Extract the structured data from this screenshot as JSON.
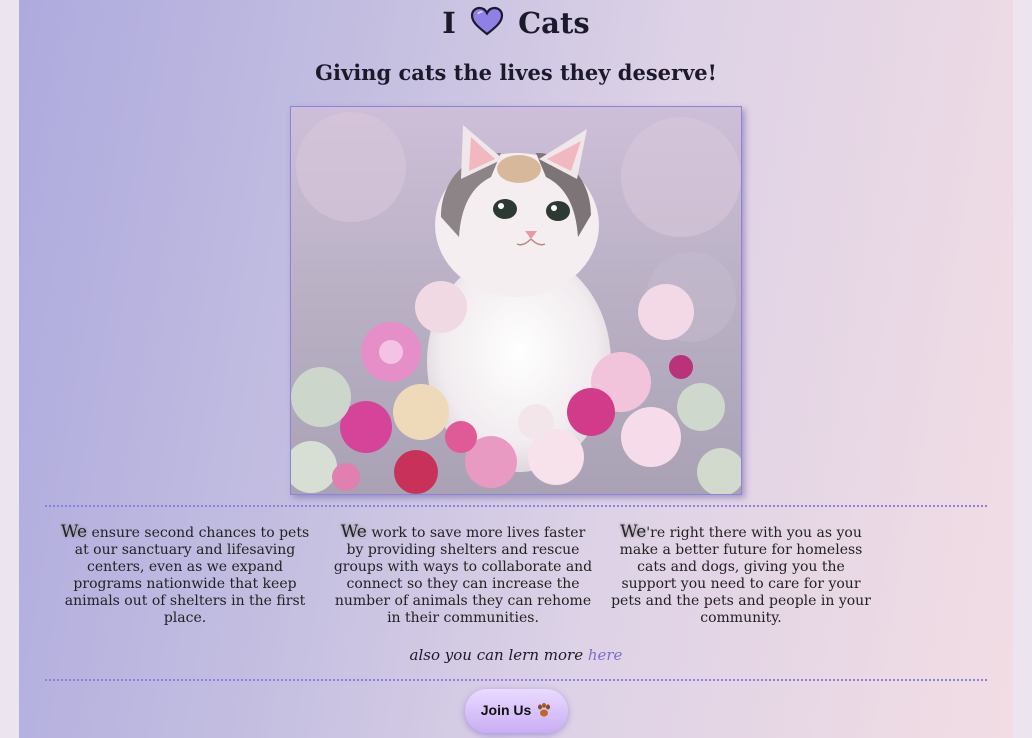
{
  "header": {
    "title_pre": "I",
    "title_post": "Cats",
    "heart_icon": "purple-heart-icon",
    "heart_color": "#8f80e6",
    "subtitle": "Giving cats the lives they deserve!"
  },
  "hero_image": {
    "icon": "kitten-with-flowers-photo"
  },
  "columns": [
    {
      "lead": "We",
      "text": " ensure second chances to pets at our sanctuary and lifesaving centers, even as we expand programs nationwide that keep animals out of shelters in the first place."
    },
    {
      "lead": "We",
      "text": " work to save more lives faster by providing shelters and rescue groups with ways to collaborate and connect so they can increase the number of animals they can rehome in their communities."
    },
    {
      "lead": "We",
      "text": "'re right there with you as you make a better future for homeless cats and dogs, giving you the support you need to care for your pets and the pets and people in your community."
    }
  ],
  "more": {
    "text": "also you can lern more ",
    "link_label": "here"
  },
  "join_button": {
    "label": "Join Us",
    "icon": "paw-icon"
  },
  "colors": {
    "accent": "#8d80de",
    "link": "#7a6fc8"
  }
}
